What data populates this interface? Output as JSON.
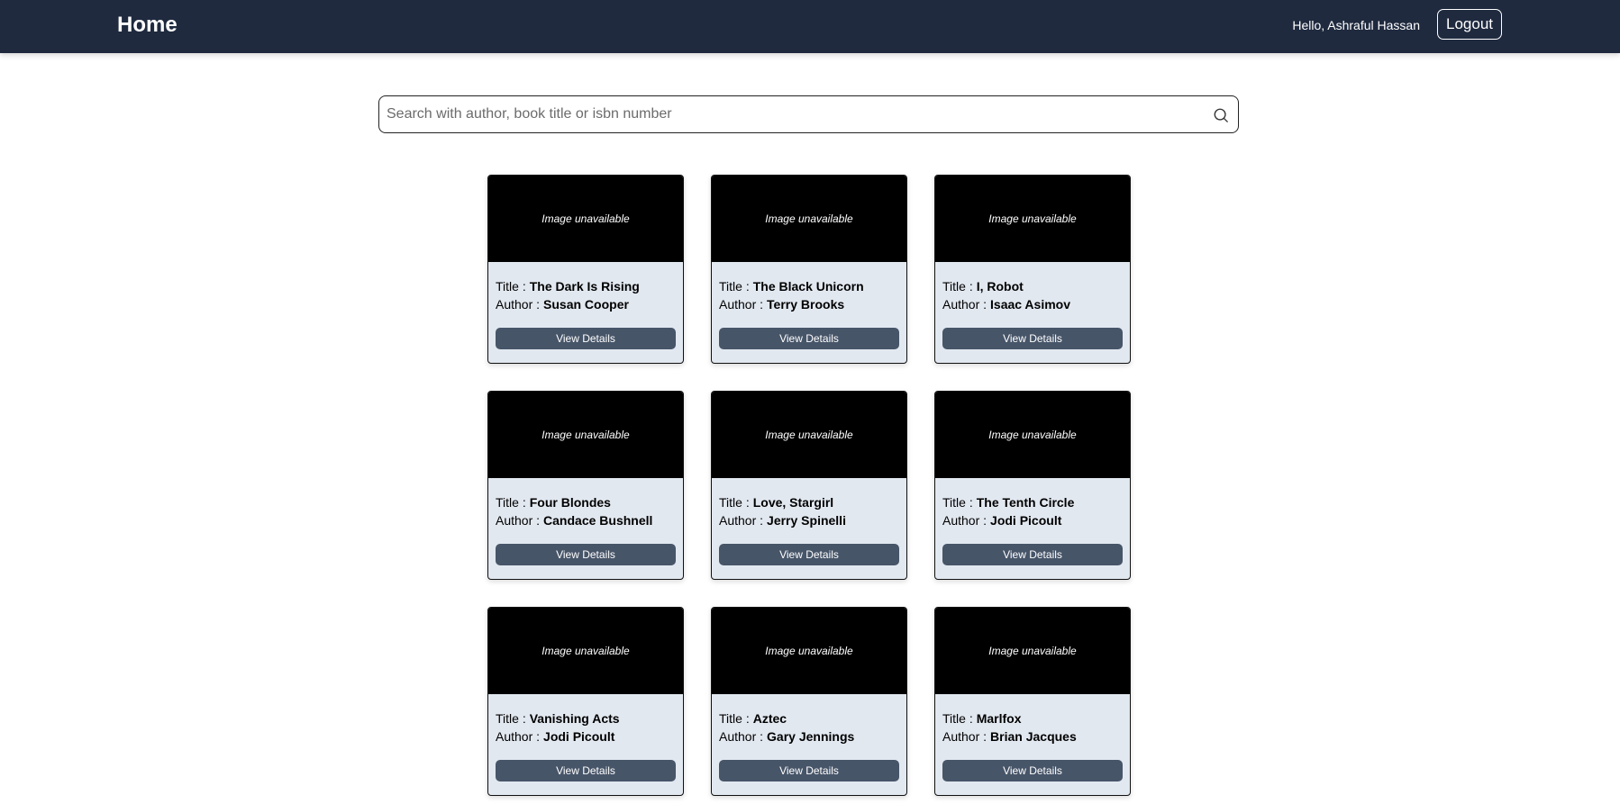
{
  "navbar": {
    "brand": "Home",
    "greeting": "Hello, Ashraful Hassan",
    "logout_label": "Logout"
  },
  "search": {
    "placeholder": "Search with author, book title or isbn number",
    "icon": "search-icon"
  },
  "labels": {
    "title": "Title :",
    "author": "Author :",
    "image_unavailable": "Image unavailable",
    "view_details": "View Details"
  },
  "books": [
    {
      "title": "The Dark Is Rising",
      "author": "Susan Cooper"
    },
    {
      "title": "The Black Unicorn",
      "author": "Terry Brooks"
    },
    {
      "title": "I, Robot",
      "author": "Isaac Asimov"
    },
    {
      "title": "Four Blondes",
      "author": "Candace Bushnell"
    },
    {
      "title": "Love, Stargirl",
      "author": "Jerry Spinelli"
    },
    {
      "title": "The Tenth Circle",
      "author": "Jodi Picoult"
    },
    {
      "title": "Vanishing Acts",
      "author": "Jodi Picoult"
    },
    {
      "title": "Aztec",
      "author": "Gary Jennings"
    },
    {
      "title": "Marlfox",
      "author": "Brian Jacques"
    }
  ],
  "colors": {
    "navbar_bg": "#1f2a3f",
    "card_bg": "#e2e8f0",
    "button_bg": "#475569",
    "image_bg": "#000000"
  }
}
